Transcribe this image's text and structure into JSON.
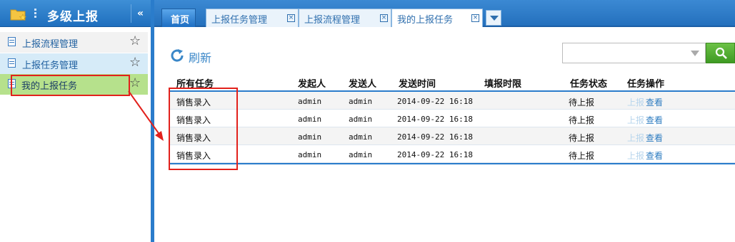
{
  "sidebar": {
    "title": "多级上报",
    "collapse": "«",
    "items": [
      {
        "label": "上报流程管理"
      },
      {
        "label": "上报任务管理"
      },
      {
        "label": "我的上报任务"
      }
    ]
  },
  "tabs": {
    "home": "首页",
    "items": [
      {
        "label": "上报任务管理"
      },
      {
        "label": "上报流程管理"
      },
      {
        "label": "我的上报任务"
      }
    ],
    "close": "⊠"
  },
  "toolbar": {
    "refresh": "刷新",
    "search_value": ""
  },
  "table": {
    "headers": [
      "所有任务",
      "发起人",
      "发送人",
      "发送时间",
      "填报时限",
      "任务状态",
      "任务操作"
    ],
    "rows": [
      {
        "task": "销售录入",
        "initiator": "admin",
        "sender": "admin",
        "time": "2014-09-22 16:18",
        "deadline": "",
        "status": "待上报",
        "act_report": "上报",
        "act_view": "查看"
      },
      {
        "task": "销售录入",
        "initiator": "admin",
        "sender": "admin",
        "time": "2014-09-22 16:18",
        "deadline": "",
        "status": "待上报",
        "act_report": "上报",
        "act_view": "查看"
      },
      {
        "task": "销售录入",
        "initiator": "admin",
        "sender": "admin",
        "time": "2014-09-22 16:18",
        "deadline": "",
        "status": "待上报",
        "act_report": "上报",
        "act_view": "查看"
      },
      {
        "task": "销售录入",
        "initiator": "admin",
        "sender": "admin",
        "time": "2014-09-22 16:18",
        "deadline": "",
        "status": "待上报",
        "act_report": "上报",
        "act_view": "查看"
      }
    ]
  },
  "colors": {
    "accent": "#2a7ccb",
    "highlight": "#e2211c",
    "selected_item": "#b6e18c"
  }
}
